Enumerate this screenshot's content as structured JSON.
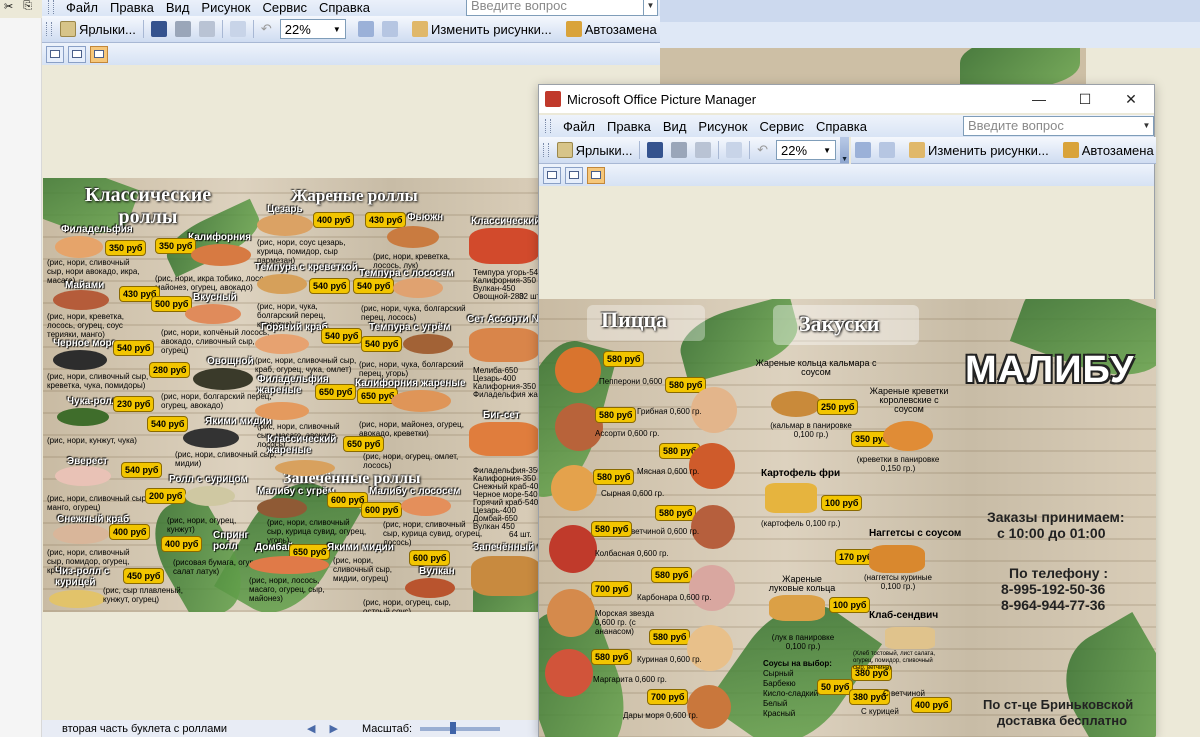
{
  "top_strip": {
    "icons": [
      "scissors-icon",
      "copy-icon"
    ]
  },
  "menu": {
    "items": [
      "Файл",
      "Правка",
      "Вид",
      "Рисунок",
      "Сервис",
      "Справка"
    ],
    "ask_placeholder": "Введите вопрос"
  },
  "toolbar": {
    "shortcuts_label": "Ярлыки...",
    "zoom_value": "22%",
    "edit_pictures_label": "Изменить рисунки...",
    "autocorrect_label": "Автозамена"
  },
  "back_window": {
    "status_text": "вторая часть буклета с роллами",
    "zoom_label": "Масштаб:"
  },
  "front_window": {
    "title": "Microsoft Office Picture Manager",
    "controls": {
      "minimize": "—",
      "maximize": "☐",
      "close": "✕"
    }
  },
  "rolls_board": {
    "sections": {
      "classic": "Классические роллы",
      "fried": "Жареные роллы",
      "baked": "Запечённые роллы"
    },
    "items": [
      {
        "name": "Филадельфия",
        "price": "350 руб",
        "desc": "(рис, нори, сливочный сыр, нори авокадо, икра, масаго)"
      },
      {
        "name": "Калифорния",
        "price": "350 руб",
        "desc": "(рис, нори, икра тобико, лосось, майонез, огурец, авокадо)"
      },
      {
        "name": "Майами",
        "price": "430 руб",
        "desc": "(рис, нори, креветка, лосось, огурец, соус терияки, манго)"
      },
      {
        "name": "Вкусный",
        "price": "500 руб",
        "desc": "(рис, нори, копчёный лосось, авокадо, сливочный сыр, огурец)"
      },
      {
        "name": "Черное море",
        "price": "540 руб",
        "desc": "(рис, нори, сливочный сыр, креветка, чука, помидоры)"
      },
      {
        "name": "Овощной",
        "price": "280 руб",
        "desc": "(рис, нори, болгарский перец, огурец, авокадо)"
      },
      {
        "name": "Чука-ролл",
        "price": "230 руб",
        "desc": "(рис, нори, кунжут, чука)"
      },
      {
        "name": "Якими мидии",
        "price": "540 руб",
        "desc": "(рис, нори, сливочный сыр, мидии)"
      },
      {
        "name": "Эверест",
        "price": "540 руб",
        "desc": "(рис, нори, сливочный сыр, манго, огурец)"
      },
      {
        "name": "Ролл с сурицом",
        "price": "200 руб",
        "desc": "(рис, нори, огурец, кунжут)"
      },
      {
        "name": "Снежный краб",
        "price": "400 руб",
        "desc": "(рис, нори, сливочный сыр, помидор, огурец, краб)"
      },
      {
        "name": "Спринг ролл",
        "price": "400 руб",
        "desc": "(рисовая бумага, огурец, салат латук)"
      },
      {
        "name": "Чиз-ролл с курицей",
        "price": "450 руб",
        "desc": "(рис, сыр плавленый, кунжут, огурец)"
      },
      {
        "name": "Цезарь",
        "price": "400 руб",
        "desc": "(рис, нори, соус цезарь, курица, помидор, сыр пармезан)"
      },
      {
        "name": "Фьюжн",
        "price": "430 руб",
        "desc": "(рис, нори, креветка, лосось, лук)"
      },
      {
        "name": "Темпура с креветкой",
        "price": "540 руб",
        "desc": "(рис, нори, чука, болгарский перец, креветка)"
      },
      {
        "name": "Темпура с лососем",
        "price": "540 руб",
        "desc": "(рис, нори, чука, болгарский перец, лосось)"
      },
      {
        "name": "Горячий краб",
        "price": "540 руб",
        "desc": "(рис, нори, сливочный сыр, краб, огурец, чука, омлет)"
      },
      {
        "name": "Темпура с угрём",
        "price": "540 руб",
        "desc": "(рис, нори, чука, болгарский перец, угорь)"
      },
      {
        "name": "Филадельфия жареные",
        "price": "650 руб",
        "desc": "(рис, нори, сливочный сыр, масаго, авокадо, лосось)"
      },
      {
        "name": "Калифорния жареные",
        "price": "650 руб",
        "desc": "(рис, нори, майонез, огурец, авокадо, креветки)"
      },
      {
        "name": "Классический жареные",
        "price": "650 руб",
        "desc": "(рис, нори, огурец, омлет, лосось)"
      },
      {
        "name": "Малибу с угрём",
        "price": "600 руб",
        "desc": "(рис, нори, сливочный сыр, курица сувид, огурец, угорь)"
      },
      {
        "name": "Малибу с лососем",
        "price": "600 руб",
        "desc": "(рис, нори, сливочный сыр, курица сувид, огурец, лосось)"
      },
      {
        "name": "Домбай",
        "price": "650 руб",
        "desc": "(рис, нори, лосось, масаго, огурец, сыр, майонез)"
      },
      {
        "name": "Якими мидии",
        "price": "600 руб",
        "desc": "(рис, нори, сливочный сыр, мидии, огурец)"
      },
      {
        "name": "Вулкан",
        "price": "600 руб",
        "desc": "(рис, нори, огурец, сыр, острый соус)"
      }
    ],
    "sets": [
      {
        "name": "Классический",
        "lines": [
          "Темпура угорь-540",
          "Калифорния-350",
          "Вулкан-450",
          "Овощной-280"
        ],
        "count": "32 шт."
      },
      {
        "name": "Сет Ассорти №",
        "lines": [
          "Мелиба-650",
          "Цезарь-400",
          "Калифорния-350",
          "Филадельфия жарен.-650"
        ],
        "count": ""
      },
      {
        "name": "Биг-сет",
        "lines": [
          "Филадельфия-350",
          "Калифорния-350",
          "Снежный краб-400",
          "Черное море-540",
          "Горячий краб-540",
          "Цезарь-400",
          "Домбай-650",
          "Вулкан 450"
        ],
        "count": "64 шт."
      },
      {
        "name": "Запечённый се",
        "lines": [],
        "count": ""
      }
    ]
  },
  "pizza_board": {
    "sections": {
      "pizza": "Пицца",
      "snacks": "Закуски"
    },
    "brand": "МАЛИБУ",
    "pizzas": [
      {
        "price": "580 руб",
        "label": "Пепперони 0,600 гр."
      },
      {
        "price": "580 руб",
        "label": "Грибная 0,600 гр."
      },
      {
        "price": "580 руб",
        "label": "Ассорти 0,600 гр."
      },
      {
        "price": "580 руб",
        "label": "Мясная 0,600 гр."
      },
      {
        "price": "580 руб",
        "label": "Сырная 0,600 гр."
      },
      {
        "price": "580 руб",
        "label": "С ветчиной 0,600 гр."
      },
      {
        "price": "580 руб",
        "label": "Колбасная 0,600 гр."
      },
      {
        "price": "580 руб",
        "label": "Карбонара 0,600 гр."
      },
      {
        "price": "700 руб",
        "label": "Морская звезда 0,600 гр. (с ананасом)"
      },
      {
        "price": "580 руб",
        "label": "Куриная 0,600 гр."
      },
      {
        "price": "580 руб",
        "label": "Маргарита 0,600 гр."
      },
      {
        "price": "700 руб",
        "label": "Дары моря 0,600 гр."
      }
    ],
    "snacks": [
      {
        "name": "Жареные кольца кальмара с соусом",
        "price": "250 руб",
        "desc": "(кальмар в панировке 0,100 гр.)"
      },
      {
        "name": "Жареные креветки королевские с соусом",
        "price": "350 руб",
        "desc": "(креветки в панировке 0,150 гр.)"
      },
      {
        "name": "Картофель фри",
        "price": "100 руб",
        "desc": "(картофель 0,100 гр.)"
      },
      {
        "name": "Наггетсы с соусом",
        "price": "170 руб",
        "desc": "(наггетсы куриные 0,100 гр.)"
      },
      {
        "name": "Жареные луковые кольца",
        "price": "100 руб",
        "desc": "(лук в панировке 0,100 гр.)"
      },
      {
        "name": "Клаб-сендвич",
        "price": "380 руб",
        "desc": "(Хлеб тостовый, лист салата, огурец, помидор, сливочный сыр, ветчина)"
      }
    ],
    "sauces": {
      "title": "Соусы на выбор:",
      "items": [
        "Сырный",
        "Барбекю",
        "Кисло-сладкий",
        "Белый",
        "Красный"
      ],
      "price": "50 руб"
    },
    "sandwich_options": [
      {
        "price": "380 руб",
        "label": "С ветчиной"
      },
      {
        "price": "400 руб",
        "label": "С курицей"
      }
    ],
    "orders": {
      "line1": "Заказы принимаем:",
      "line2": "с 10:00 до 01:00",
      "phone_label": "По телефону :",
      "phone1": "8-995-192-50-36",
      "phone2": "8-964-944-77-36",
      "delivery1": "По ст-це Бриньковской",
      "delivery2": "доставка бесплатно"
    }
  },
  "colors": {
    "menubar": "#dce6f5",
    "price_badge": "#f2c500",
    "leaf_green": "#3f7f34",
    "accent_view": "#f6c77a"
  }
}
